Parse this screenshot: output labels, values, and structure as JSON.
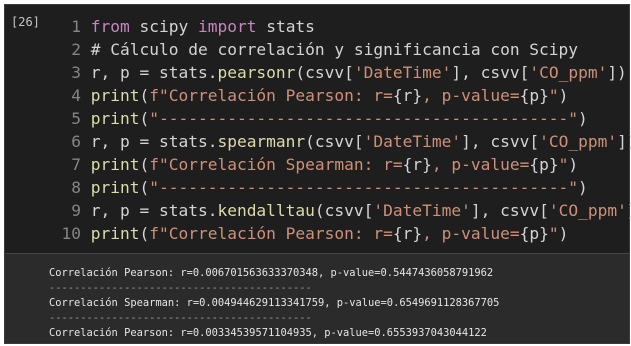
{
  "cell": {
    "execution_count": "[26]",
    "code_lines": [
      {
        "n": "1",
        "segments": [
          {
            "t": "from",
            "c": "kw"
          },
          {
            "t": " scipy ",
            "c": ""
          },
          {
            "t": "import",
            "c": "kw"
          },
          {
            "t": " stats",
            "c": ""
          }
        ]
      },
      {
        "n": "2",
        "segments": [
          {
            "t": "# Cálculo de correlación y significancia con Scipy",
            "c": ""
          }
        ]
      },
      {
        "n": "3",
        "segments": [
          {
            "t": "r, p = stats.",
            "c": ""
          },
          {
            "t": "pearsonr",
            "c": "fn"
          },
          {
            "t": "(csvv[",
            "c": ""
          },
          {
            "t": "'DateTime'",
            "c": "str"
          },
          {
            "t": "], csvv[",
            "c": ""
          },
          {
            "t": "'CO_ppm'",
            "c": "str"
          },
          {
            "t": "])",
            "c": ""
          }
        ]
      },
      {
        "n": "4",
        "segments": [
          {
            "t": "print",
            "c": "fn"
          },
          {
            "t": "(",
            "c": ""
          },
          {
            "t": "f\"Correlación Pearson: r=",
            "c": "str"
          },
          {
            "t": "{r}",
            "c": ""
          },
          {
            "t": ", p-value=",
            "c": "str"
          },
          {
            "t": "{p}",
            "c": ""
          },
          {
            "t": "\"",
            "c": "str"
          },
          {
            "t": ")",
            "c": ""
          }
        ]
      },
      {
        "n": "5",
        "segments": [
          {
            "t": "print",
            "c": "fn"
          },
          {
            "t": "(",
            "c": ""
          },
          {
            "t": "\"------------------------------------------\"",
            "c": "str"
          },
          {
            "t": ")",
            "c": ""
          }
        ]
      },
      {
        "n": "6",
        "segments": [
          {
            "t": "r, p = stats.",
            "c": ""
          },
          {
            "t": "spearmanr",
            "c": "fn"
          },
          {
            "t": "(csvv[",
            "c": ""
          },
          {
            "t": "'DateTime'",
            "c": "str"
          },
          {
            "t": "], csvv[",
            "c": ""
          },
          {
            "t": "'CO_ppm'",
            "c": "str"
          },
          {
            "t": "])",
            "c": ""
          }
        ]
      },
      {
        "n": "7",
        "segments": [
          {
            "t": "print",
            "c": "fn"
          },
          {
            "t": "(",
            "c": ""
          },
          {
            "t": "f\"Correlación Spearman: r=",
            "c": "str"
          },
          {
            "t": "{r}",
            "c": ""
          },
          {
            "t": ", p-value=",
            "c": "str"
          },
          {
            "t": "{p}",
            "c": ""
          },
          {
            "t": "\"",
            "c": "str"
          },
          {
            "t": ")",
            "c": ""
          }
        ]
      },
      {
        "n": "8",
        "segments": [
          {
            "t": "print",
            "c": "fn"
          },
          {
            "t": "(",
            "c": ""
          },
          {
            "t": "\"------------------------------------------\"",
            "c": "str"
          },
          {
            "t": ")",
            "c": ""
          }
        ]
      },
      {
        "n": "9",
        "segments": [
          {
            "t": "r, p = stats.",
            "c": ""
          },
          {
            "t": "kendalltau",
            "c": "fn"
          },
          {
            "t": "(csvv[",
            "c": ""
          },
          {
            "t": "'DateTime'",
            "c": "str"
          },
          {
            "t": "], csvv[",
            "c": ""
          },
          {
            "t": "'CO_ppm'",
            "c": "str"
          },
          {
            "t": "])",
            "c": ""
          }
        ]
      },
      {
        "n": "10",
        "segments": [
          {
            "t": "print",
            "c": "fn"
          },
          {
            "t": "(",
            "c": ""
          },
          {
            "t": "f\"Correlación Pearson: r=",
            "c": "str"
          },
          {
            "t": "{r}",
            "c": ""
          },
          {
            "t": ", p-value=",
            "c": "str"
          },
          {
            "t": "{p}",
            "c": ""
          },
          {
            "t": "\"",
            "c": "str"
          },
          {
            "t": ")",
            "c": ""
          }
        ]
      }
    ],
    "output_lines": [
      "Correlación Pearson: r=0.006701563633370348, p-value=0.5447436058791962",
      "------------------------------------------",
      "Correlación Spearman: r=0.004944629113341759, p-value=0.6549691128367705",
      "------------------------------------------",
      "Correlación Pearson: r=0.00334539571104935, p-value=0.6553937043044122"
    ]
  }
}
